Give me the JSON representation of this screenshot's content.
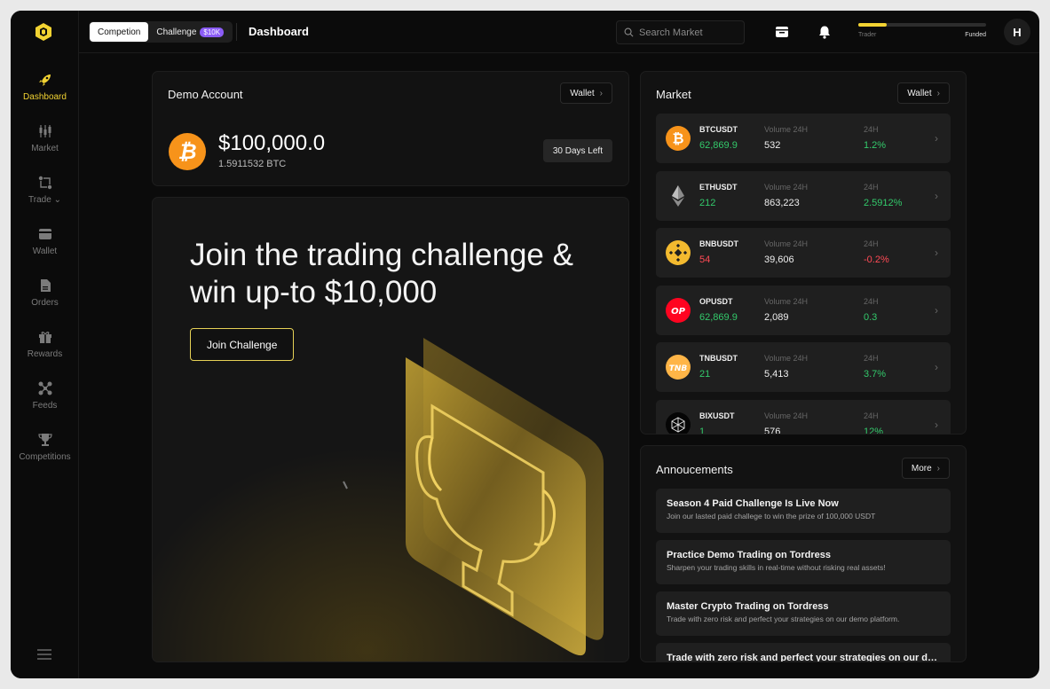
{
  "sidebar": {
    "items": [
      {
        "label": "Dashboard",
        "icon": "rocket-icon"
      },
      {
        "label": "Market",
        "icon": "candlestick-icon"
      },
      {
        "label": "Trade",
        "icon": "swap-icon"
      },
      {
        "label": "Wallet",
        "icon": "wallet-icon"
      },
      {
        "label": "Orders",
        "icon": "document-icon"
      },
      {
        "label": "Rewards",
        "icon": "gift-icon"
      },
      {
        "label": "Feeds",
        "icon": "network-icon"
      },
      {
        "label": "Competitions",
        "icon": "trophy-icon"
      }
    ],
    "active": "Dashboard"
  },
  "topbar": {
    "segment": {
      "competition": "Competion",
      "challenge": "Challenge",
      "challenge_badge": "$10K"
    },
    "title": "Dashboard",
    "search_placeholder": "Search Market",
    "progress": {
      "left_label": "Trader",
      "right_label": "Funded",
      "fraction": 0.22
    },
    "avatar_initial": "H"
  },
  "demo_account": {
    "title": "Demo Account",
    "wallet_button": "Wallet",
    "balance": "$100,000.0",
    "btc_amount": "1.5911532 BTC",
    "days_left": "30 Days Left"
  },
  "hero": {
    "title": "Join the trading challenge & win up-to $10,000",
    "button": "Join Challenge"
  },
  "market": {
    "title": "Market",
    "wallet_button": "Wallet",
    "volume_label": "Volume 24H",
    "change_label": "24H",
    "rows": [
      {
        "symbol": "BTCUSDT",
        "price": "62,869.9",
        "volume": "532",
        "change": "1.2%",
        "trend": "up"
      },
      {
        "symbol": "ETHUSDT",
        "price": "212",
        "volume": "863,223",
        "change": "2.5912%",
        "trend": "up"
      },
      {
        "symbol": "BNBUSDT",
        "price": "54",
        "volume": "39,606",
        "change": "-0.2%",
        "trend": "down"
      },
      {
        "symbol": "OPUSDT",
        "price": "62,869.9",
        "volume": "2,089",
        "change": "0.3",
        "trend": "up"
      },
      {
        "symbol": "TNBUSDT",
        "price": "21",
        "volume": "5,413",
        "change": "3.7%",
        "trend": "up"
      },
      {
        "symbol": "BIXUSDT",
        "price": "1",
        "volume": "576",
        "change": "12%",
        "trend": "up"
      }
    ]
  },
  "announcements": {
    "title": "Annoucements",
    "more_button": "More",
    "items": [
      {
        "title": "Season 4 Paid Challenge Is Live Now",
        "subtitle": "Join our lasted paid challege to win the prize of 100,000 USDT"
      },
      {
        "title": "Practice Demo Trading on Tordress",
        "subtitle": "Sharpen your trading skills in real-time without risking real assets!"
      },
      {
        "title": "Master Crypto Trading on Tordress",
        "subtitle": "Trade with zero risk and perfect your strategies on our demo platform."
      },
      {
        "title": "Trade with zero risk and perfect your strategies on our demo...",
        "subtitle": ""
      }
    ]
  },
  "colors": {
    "accent": "#f2d332",
    "positive": "#33c96b",
    "negative": "#ff4a55",
    "badge": "#8b5cf6"
  }
}
